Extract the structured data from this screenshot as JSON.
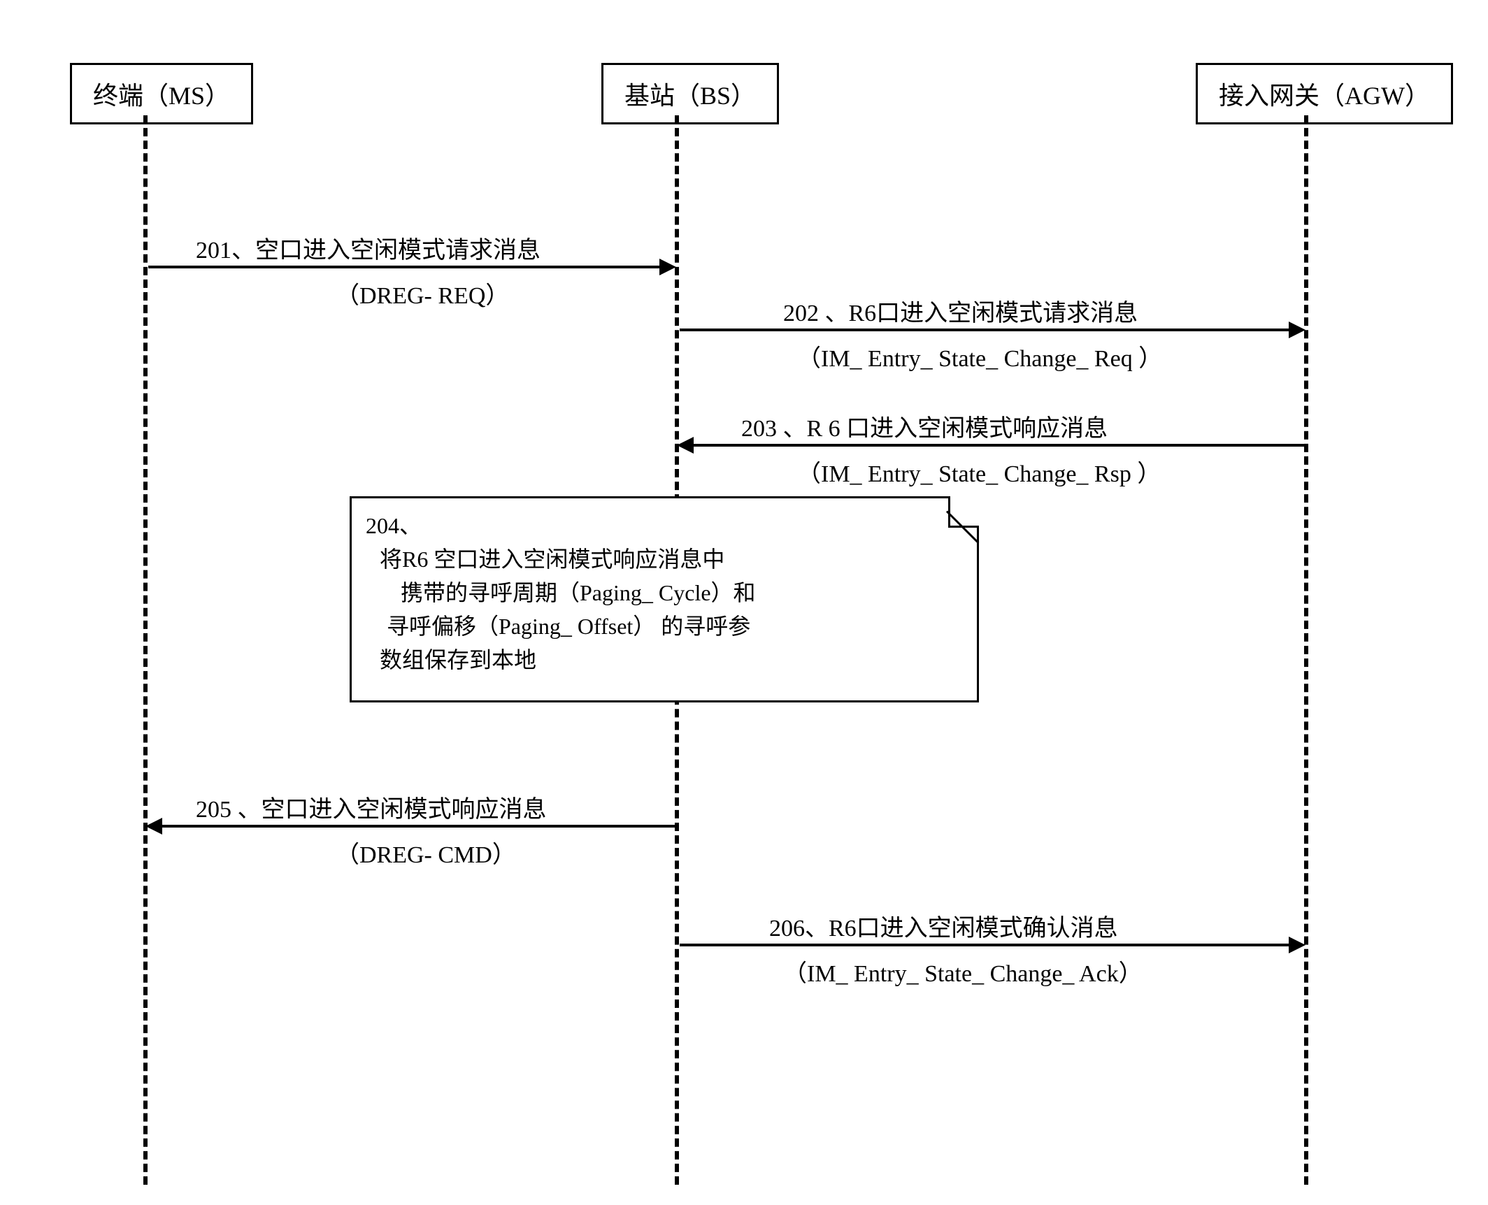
{
  "actors": {
    "ms": "终端（MS）",
    "bs": "基站（BS）",
    "agw": "接入网关（AGW）"
  },
  "messages": {
    "m201": {
      "label": "201、空口进入空闲模式请求消息",
      "sub": "（DREG- REQ）"
    },
    "m202": {
      "label": "202 、R6口进入空闲模式请求消息",
      "sub": "（IM_ Entry_ State_ Change_ Req ）"
    },
    "m203": {
      "label": "203 、R 6 口进入空闲模式响应消息",
      "sub": "（IM_ Entry_ State_ Change_ Rsp ）"
    },
    "m205": {
      "label": "205 、空口进入空闲模式响应消息",
      "sub": "（DREG- CMD）"
    },
    "m206": {
      "label": "206、R6口进入空闲模式确认消息",
      "sub": "（IM_ Entry_ State_ Change_ Ack）"
    }
  },
  "note": {
    "num": "204、",
    "line1": "将R6 空口进入空闲模式响应消息中",
    "line2": "携带的寻呼周期（Paging_ Cycle）和",
    "line3": "寻呼偏移（Paging_ Offset） 的寻呼参",
    "line4": "数组保存到本地"
  }
}
